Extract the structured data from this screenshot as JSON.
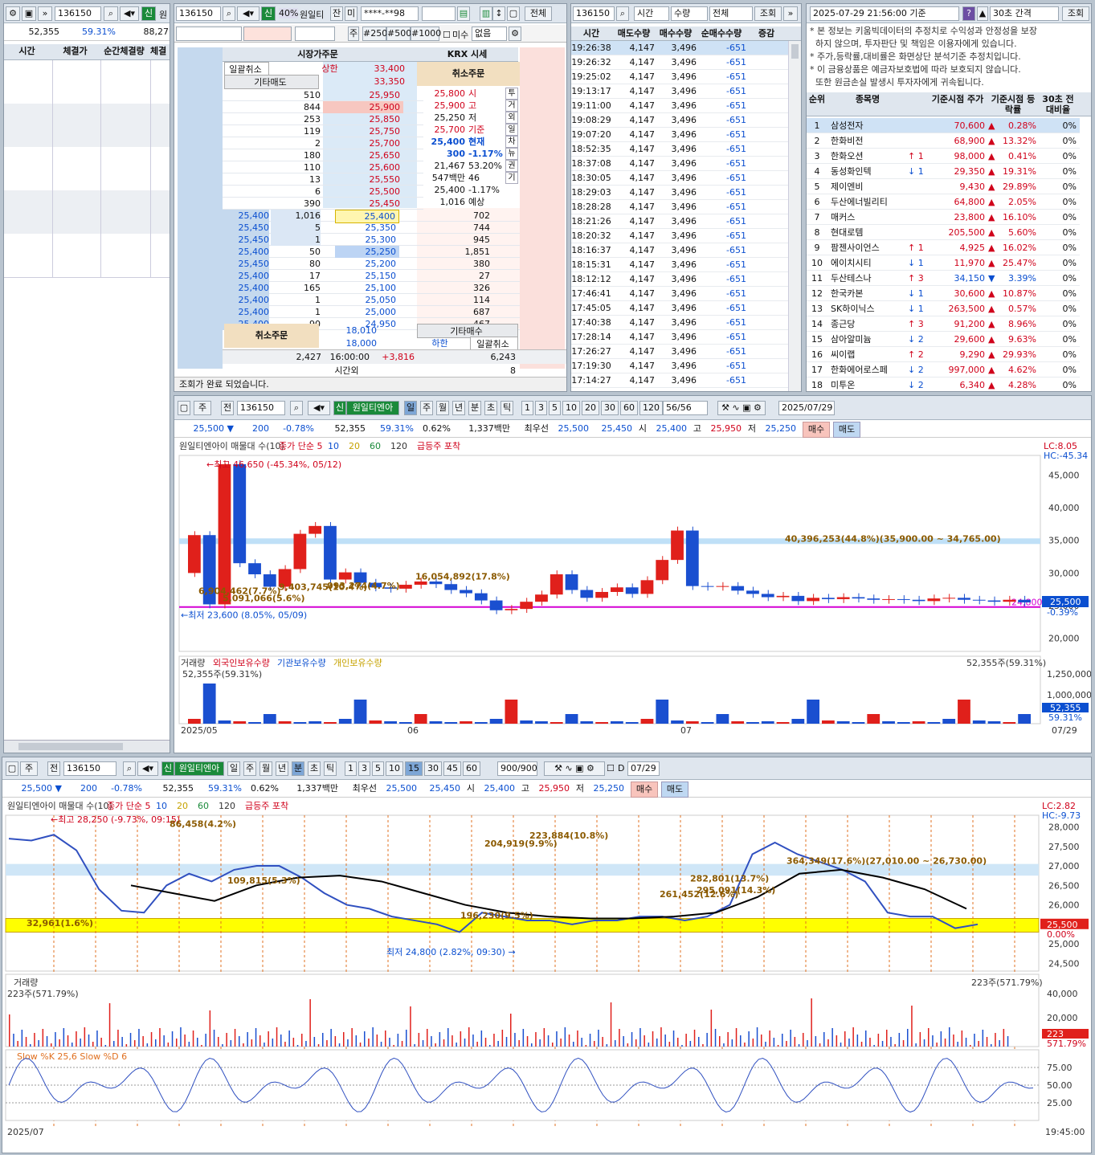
{
  "left_panel": {
    "code": "136150",
    "tag": "신",
    "name_short": "원",
    "qty": "52,355",
    "pct": "59.31%",
    "other": "88,27",
    "columns": [
      "시간",
      "체결가",
      "순간체결량",
      "체결"
    ]
  },
  "order_panel": {
    "code": "136150",
    "tag": "신",
    "margin": "40%",
    "name": "원일티",
    "btn_jan": "잔",
    "btn_mi": "미",
    "account": "****-**98",
    "btn_all": "전체",
    "col_market": "시장가주문",
    "col_krx": "KRX 시세",
    "cancel_all": "일괄취소",
    "upper_label": "상한",
    "upper_price": "33,400",
    "other_sell": "기타매도",
    "cancel_order": "취소주문",
    "price_top": "33,350",
    "ask_rows": [
      {
        "qty": "510",
        "price": "25,950"
      },
      {
        "qty": "844",
        "price": "25,900"
      },
      {
        "qty": "253",
        "price": "25,850"
      },
      {
        "qty": "119",
        "price": "25,750"
      },
      {
        "qty": "2",
        "price": "25,700"
      },
      {
        "qty": "180",
        "price": "25,650"
      },
      {
        "qty": "110",
        "price": "25,600"
      },
      {
        "qty": "13",
        "price": "25,550"
      },
      {
        "qty": "6",
        "price": "25,500"
      },
      {
        "qty": "390",
        "price": "25,450"
      }
    ],
    "bid_rows": [
      {
        "price": "25,400",
        "qty": "702",
        "left_price": "25,400",
        "left_qty": "1,016"
      },
      {
        "price": "25,350",
        "qty": "744",
        "left_price": "25,450",
        "left_qty": "5"
      },
      {
        "price": "25,300",
        "qty": "945",
        "left_price": "25,450",
        "left_qty": "1"
      },
      {
        "price": "25,250",
        "qty": "1,851",
        "left_price": "25,400",
        "left_qty": "50"
      },
      {
        "price": "25,200",
        "qty": "380",
        "left_price": "25,450",
        "left_qty": "80"
      },
      {
        "price": "25,150",
        "qty": "27",
        "left_price": "25,400",
        "left_qty": "17"
      },
      {
        "price": "25,100",
        "qty": "326",
        "left_price": "25,400",
        "left_qty": "165"
      },
      {
        "price": "25,050",
        "qty": "114",
        "left_price": "25,400",
        "left_qty": "1"
      },
      {
        "price": "25,000",
        "qty": "687",
        "left_price": "25,400",
        "left_qty": "1"
      },
      {
        "price": "24,950",
        "qty": "467",
        "left_price": "25,400",
        "left_qty": "90"
      }
    ],
    "info": [
      {
        "v": "25,800",
        "k": "시"
      },
      {
        "v": "25,900",
        "k": "고"
      },
      {
        "v": "25,250",
        "k": "저"
      },
      {
        "v": "25,700",
        "k": "기준"
      },
      {
        "v": "25,400",
        "k": "현재"
      },
      {
        "v": "300",
        "k": "-1.17%"
      },
      {
        "v": "21,467",
        "k": "53.20%"
      },
      {
        "v": "547백만",
        "k": "46"
      },
      {
        "v": "25,400",
        "k": "-1.17%"
      },
      {
        "v": "1,016",
        "k": "예상"
      }
    ],
    "side_tabs": [
      "투",
      "거",
      "외",
      "일",
      "차",
      "뉴",
      "권",
      "기"
    ],
    "low_price_1": "18,010",
    "low_price_2": "18,000",
    "lower_label": "하한",
    "other_buy": "기타매수",
    "total_ask": "2,427",
    "time": "16:00:00",
    "diff": "+3,816",
    "total_bid": "6,243",
    "after_hours": "시간외",
    "after_qty": "8",
    "status": "조회가 완료 되었습니다.",
    "qty_buttons": [
      "주",
      "#250",
      "#500",
      "#1000"
    ],
    "misu": "미수",
    "none_opt": "없음"
  },
  "trade_list": {
    "code": "136150",
    "filter1": "시간",
    "filter2": "수량",
    "filter3": "전체",
    "search": "조회",
    "columns": [
      "시간",
      "매도수량",
      "매수수량",
      "순매수수량",
      "증감"
    ],
    "rows": [
      [
        "19:26:38",
        "4,147",
        "3,496",
        "-651"
      ],
      [
        "19:26:32",
        "4,147",
        "3,496",
        "-651"
      ],
      [
        "19:25:02",
        "4,147",
        "3,496",
        "-651"
      ],
      [
        "19:13:17",
        "4,147",
        "3,496",
        "-651"
      ],
      [
        "19:11:00",
        "4,147",
        "3,496",
        "-651"
      ],
      [
        "19:08:29",
        "4,147",
        "3,496",
        "-651"
      ],
      [
        "19:07:20",
        "4,147",
        "3,496",
        "-651"
      ],
      [
        "18:52:35",
        "4,147",
        "3,496",
        "-651"
      ],
      [
        "18:37:08",
        "4,147",
        "3,496",
        "-651"
      ],
      [
        "18:30:05",
        "4,147",
        "3,496",
        "-651"
      ],
      [
        "18:29:03",
        "4,147",
        "3,496",
        "-651"
      ],
      [
        "18:28:28",
        "4,147",
        "3,496",
        "-651"
      ],
      [
        "18:21:26",
        "4,147",
        "3,496",
        "-651"
      ],
      [
        "18:20:32",
        "4,147",
        "3,496",
        "-651"
      ],
      [
        "18:16:37",
        "4,147",
        "3,496",
        "-651"
      ],
      [
        "18:15:31",
        "4,147",
        "3,496",
        "-651"
      ],
      [
        "18:12:12",
        "4,147",
        "3,496",
        "-651"
      ],
      [
        "17:46:41",
        "4,147",
        "3,496",
        "-651"
      ],
      [
        "17:45:05",
        "4,147",
        "3,496",
        "-651"
      ],
      [
        "17:40:38",
        "4,147",
        "3,496",
        "-651"
      ],
      [
        "17:28:14",
        "4,147",
        "3,496",
        "-651"
      ],
      [
        "17:26:27",
        "4,147",
        "3,496",
        "-651"
      ],
      [
        "17:19:30",
        "4,147",
        "3,496",
        "-651"
      ],
      [
        "17:14:27",
        "4,147",
        "3,496",
        "-651"
      ]
    ]
  },
  "ranking": {
    "datetime": "2025-07-29 21:56:00 기준",
    "help": "?",
    "interval": "30초 간격",
    "search": "조회",
    "notice": [
      "* 본 정보는 키움빅데이터의 추정치로 수익성과 안정성을 보장",
      "  하지 않으며, 투자판단 및 책임은 이용자에게 있습니다.",
      "* 주가,등락률,대비률은 화면상단 분석기준 추정치입니다.",
      "* 이 금융상품은 예금자보호법에 따라 보호되지 않습니다.",
      "  또한 원금손실 발생시 투자자에게 귀속됩니다."
    ],
    "columns": [
      "순위",
      "종목명",
      "기준시점 주가",
      "기준시점 등락률",
      "30초 전 대비율"
    ],
    "rows": [
      {
        "rank": "1",
        "name": "삼성전자",
        "chg": "",
        "price": "70,600",
        "rate": "0.28%",
        "r30": "0%"
      },
      {
        "rank": "2",
        "name": "한화비전",
        "chg": "",
        "price": "68,900",
        "rate": "13.32%",
        "r30": "0%"
      },
      {
        "rank": "3",
        "name": "한화오션",
        "chg": "↑ 1",
        "price": "98,000",
        "rate": "0.41%",
        "r30": "0%"
      },
      {
        "rank": "4",
        "name": "동성화인텍",
        "chg": "↓ 1",
        "price": "29,350",
        "rate": "19.31%",
        "r30": "0%"
      },
      {
        "rank": "5",
        "name": "제이엔비",
        "chg": "",
        "price": "9,430",
        "rate": "29.89%",
        "r30": "0%"
      },
      {
        "rank": "6",
        "name": "두산에너빌리티",
        "chg": "",
        "price": "64,800",
        "rate": "2.05%",
        "r30": "0%"
      },
      {
        "rank": "7",
        "name": "매커스",
        "chg": "",
        "price": "23,800",
        "rate": "16.10%",
        "r30": "0%"
      },
      {
        "rank": "8",
        "name": "현대로템",
        "chg": "",
        "price": "205,500",
        "rate": "5.60%",
        "r30": "0%"
      },
      {
        "rank": "9",
        "name": "팜젠사이언스",
        "chg": "↑ 1",
        "price": "4,925",
        "rate": "16.02%",
        "r30": "0%"
      },
      {
        "rank": "10",
        "name": "에이치시티",
        "chg": "↓ 1",
        "price": "11,970",
        "rate": "25.47%",
        "r30": "0%"
      },
      {
        "rank": "11",
        "name": "두산테스나",
        "chg": "↑ 3",
        "price": "34,150",
        "rate": "3.39%",
        "r30": "0%"
      },
      {
        "rank": "12",
        "name": "한국카본",
        "chg": "↓ 1",
        "price": "30,600",
        "rate": "10.87%",
        "r30": "0%"
      },
      {
        "rank": "13",
        "name": "SK하이닉스",
        "chg": "↓ 1",
        "price": "263,500",
        "rate": "0.57%",
        "r30": "0%"
      },
      {
        "rank": "14",
        "name": "종근당",
        "chg": "↑ 3",
        "price": "91,200",
        "rate": "8.96%",
        "r30": "0%"
      },
      {
        "rank": "15",
        "name": "삼아알미늄",
        "chg": "↓ 2",
        "price": "29,600",
        "rate": "9.63%",
        "r30": "0%"
      },
      {
        "rank": "16",
        "name": "씨이랩",
        "chg": "↑ 2",
        "price": "9,290",
        "rate": "29.93%",
        "r30": "0%"
      },
      {
        "rank": "17",
        "name": "한화에어로스페",
        "chg": "↓ 2",
        "price": "997,000",
        "rate": "4.62%",
        "r30": "0%"
      },
      {
        "rank": "18",
        "name": "미투온",
        "chg": "↓ 2",
        "price": "6,340",
        "rate": "4.28%",
        "r30": "0%"
      }
    ]
  },
  "daily_chart": {
    "code": "136150",
    "tag": "신",
    "name": "원일티엔아",
    "periods": [
      "일",
      "주",
      "월",
      "년",
      "분",
      "초",
      "틱"
    ],
    "nums": [
      "1",
      "3",
      "5",
      "10",
      "20",
      "30",
      "60",
      "120"
    ],
    "count": "56/56",
    "date": "2025/07/29",
    "price": "25,500",
    "change": "200",
    "change_pct": "-0.78%",
    "vol": "52,355",
    "vol_pct": "59.31%",
    "turn": "0.62%",
    "amount": "1,337백만",
    "best": "최우선",
    "ask": "25,500",
    "bid": "25,450",
    "open_k": "시",
    "open": "25,400",
    "high_k": "고",
    "high": "25,950",
    "low_k": "저",
    "low": "25,250",
    "buy": "매수",
    "sell": "매도",
    "legend": [
      "원일티엔아이 매물대 수(10)",
      "종가 단순 5",
      "10",
      "20",
      "60",
      "120",
      "급등주 포착"
    ],
    "lc": "LC:8.05",
    "hc": "HC:-45.34",
    "max_label": "최고 46,650 (-45.34%, 05/12)",
    "min_label": "최저 23,600 (8.05%, 05/09)",
    "profile_label": "40,396,253(44.8%)(35,900.00 ~ 34,765.00)",
    "labels": [
      "16,054,892(17.8%)",
      "6,904,462(7.7%)",
      "9,403,745(10.4%)",
      "5,091,066(5.6%)",
      "093,274(4.7%)"
    ],
    "line_label": "24,800",
    "cur_tag": "25,500",
    "cur_pct": "-0.39%",
    "y_ticks": [
      "45,000",
      "40,000",
      "35,000",
      "30,000",
      "25,000",
      "20,000"
    ],
    "sub_legend": [
      "거래량",
      "외국인보유수량",
      "기관보유수량",
      "개인보유수량"
    ],
    "sub_left": "52,355주(59.31%)",
    "sub_right": "52,355주(59.31%)",
    "sub_ticks": [
      "1,250,000",
      "1,000,000"
    ],
    "sub_tag1": "52,355",
    "sub_tag2": "59.31%",
    "x_labels": [
      "2025/05",
      "06",
      "07"
    ],
    "x_end": "07/29"
  },
  "minute_chart": {
    "code": "136150",
    "tag": "신",
    "name": "원일티엔아",
    "periods": [
      "일",
      "주",
      "월",
      "년",
      "분",
      "초",
      "틱"
    ],
    "nums": [
      "1",
      "3",
      "5",
      "10",
      "15",
      "30",
      "45",
      "60"
    ],
    "sel": "15",
    "count": "900/900",
    "date": "07/29",
    "dchk": "D",
    "price": "25,500",
    "change": "200",
    "change_pct": "-0.78%",
    "vol": "52,355",
    "vol_pct": "59.31%",
    "turn": "0.62%",
    "amount": "1,337백만",
    "best": "최우선",
    "ask": "25,500",
    "bid": "25,450",
    "open_k": "시",
    "open": "25,400",
    "high_k": "고",
    "high": "25,950",
    "low_k": "저",
    "low": "25,250",
    "buy": "매수",
    "sell": "매도",
    "legend": [
      "원일티엔아이 매물대 수(10)",
      "종가 단순 5",
      "10",
      "20",
      "60",
      "120",
      "급등주 포착"
    ],
    "lc": "LC:2.82",
    "hc": "HC:-9.73",
    "max_label": "최고 28,250 (-9.73%, 09:15)",
    "min_label": "최저 24,800 (2.82%, 09:30)",
    "profile_labels": [
      "86,458(4.2%)",
      "223,884(10.8%)",
      "204,919(9.9%)",
      "109,815(5.3%)",
      "282,801(13.7%)",
      "364,349(17.6%)(27,010.00 ~ 26,730.00)",
      "295,091(14.3%)",
      "196,230(9.5%)",
      "32,961(1.6%)",
      "261,452(12.6%)"
    ],
    "cur_tag": "25,500",
    "cur_pct": "0.00%",
    "y_ticks": [
      "28,000",
      "27,500",
      "27,000",
      "26,500",
      "26,000",
      "25,500",
      "25,000",
      "24,500"
    ],
    "vol_legend": "거래량",
    "vol_left": "223주(571.79%)",
    "vol_right": "223주(571.79%)",
    "vol_ticks": [
      "40,000",
      "20,000"
    ],
    "vol_tag1": "223",
    "vol_tag2": "571.79%",
    "stoch_legend": "Slow %K 25,6  Slow %D 6",
    "stoch_ticks": [
      "75.00",
      "50.00",
      "25.00"
    ],
    "x_start": "2025/07",
    "x_end": "19:45:00"
  }
}
